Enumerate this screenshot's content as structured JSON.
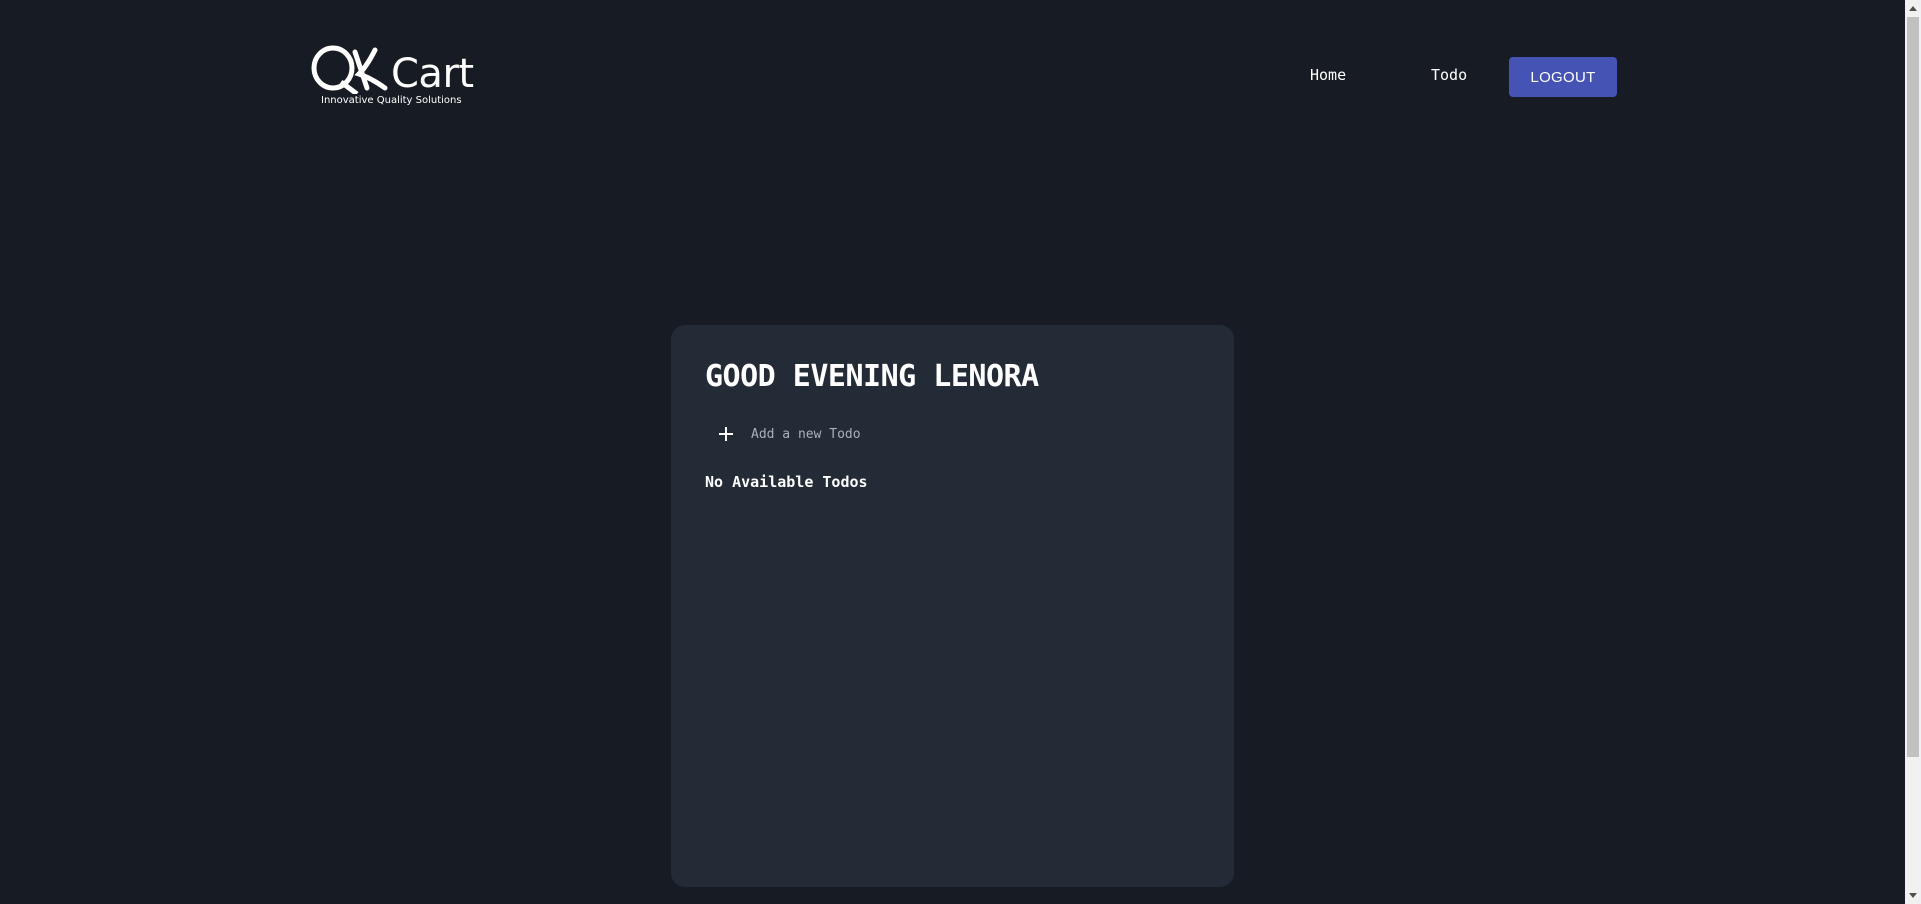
{
  "logo": {
    "wordmark": "Cart",
    "tagline": "Innovative Quality Solutions"
  },
  "nav": {
    "home_label": "Home",
    "todo_label": "Todo",
    "logout_label": "LOGOUT"
  },
  "todo_card": {
    "greeting": "GOOD EVENING LENORA",
    "add_placeholder": "Add a new Todo",
    "add_icon": "plus-icon",
    "empty_message": "No Available Todos"
  },
  "colors": {
    "background": "#171c24",
    "card": "#222b36",
    "accent_button": "#4553b5",
    "text": "#ffffff",
    "placeholder": "#a9b1bc"
  }
}
